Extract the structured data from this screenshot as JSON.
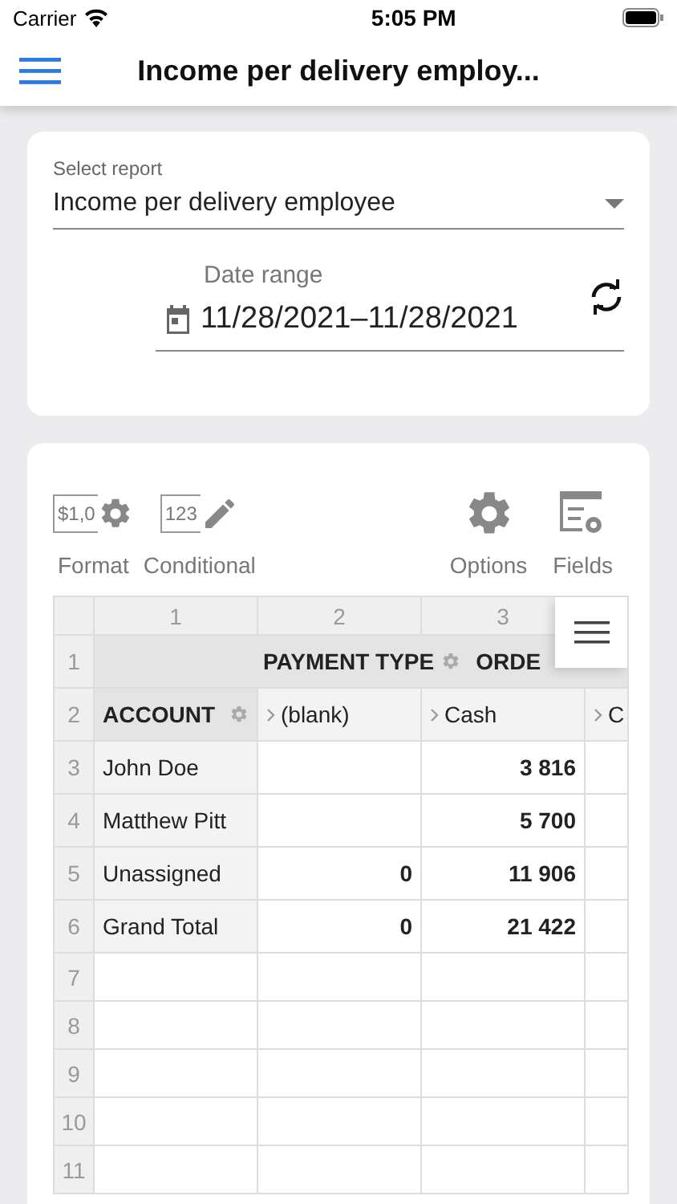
{
  "status_bar": {
    "carrier": "Carrier",
    "time": "5:05 PM"
  },
  "header": {
    "title": "Income per delivery employ..."
  },
  "report": {
    "label": "Select report",
    "value": "Income per delivery employee"
  },
  "date_range": {
    "label": "Date range",
    "value": "11/28/2021–11/28/2021"
  },
  "toolbar": [
    {
      "kind": "format",
      "label": "Format",
      "badge": "$1,0"
    },
    {
      "kind": "conditional",
      "label": "Conditional",
      "badge": "123"
    },
    {
      "kind": "options",
      "label": "Options"
    },
    {
      "kind": "fields",
      "label": "Fields"
    }
  ],
  "grid": {
    "column_numbers": [
      "1",
      "2",
      "3"
    ],
    "header_row": {
      "row_number": "1",
      "column_field": "PAYMENT TYPE",
      "next_field": "ORDE"
    },
    "field_row": {
      "row_number": "2",
      "row_field": "ACCOUNT",
      "members": [
        "(blank)",
        "Cash",
        "C"
      ]
    },
    "rows": [
      {
        "row_number": "3",
        "label": "John Doe",
        "column_3": "3 816"
      },
      {
        "row_number": "4",
        "label": "Matthew Pitt",
        "column_3": "5 700"
      },
      {
        "row_number": "5",
        "label": "Unassigned",
        "column_2": "0",
        "column_3": "11 906"
      },
      {
        "row_number": "6",
        "label": "Grand Total",
        "column_2": "0",
        "column_3": "21 422"
      }
    ],
    "empty_rows": [
      "7",
      "8",
      "9",
      "10",
      "11"
    ]
  }
}
